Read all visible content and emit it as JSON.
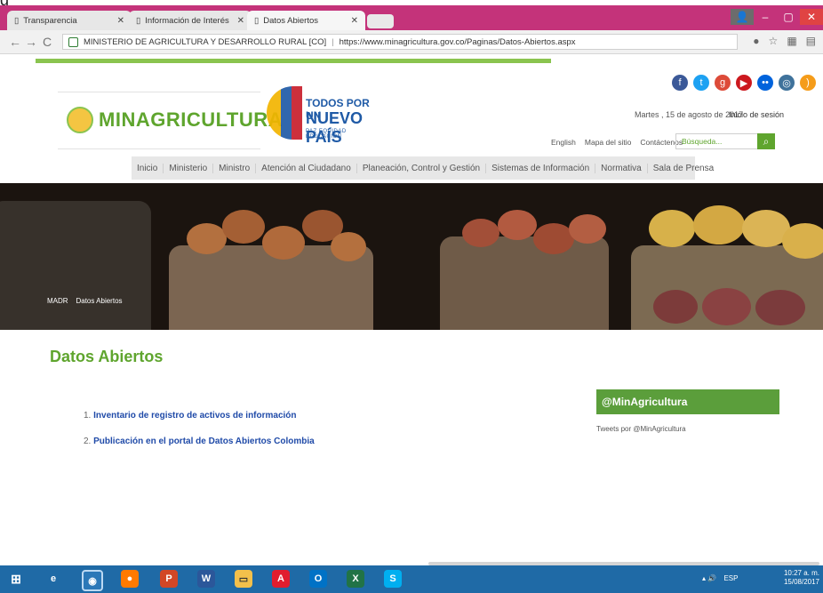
{
  "window": {
    "top_glyph": "g",
    "tabs": [
      {
        "label": "Transparencia"
      },
      {
        "label": "Información de Interés"
      },
      {
        "label": "Datos Abiertos"
      }
    ],
    "address": {
      "site_identity": "MINISTERIO DE AGRICULTURA Y DESARROLLO RURAL [CO]",
      "url": "https://www.minagricultura.gov.co/Paginas/Datos-Abiertos.aspx"
    }
  },
  "site": {
    "brand": "MINAGRICULTURA",
    "campaign": {
      "line1": "TODOS POR UN",
      "line2": "NUEVO PAÍS",
      "line3": "PAZ  EQUIDAD  EDUCACIÓN"
    },
    "date_text": "Martes , 15 de agosto de 2017",
    "login_label": "Inicio de sesión",
    "utility_links": [
      "English",
      "Mapa del sitio",
      "Contáctenos"
    ],
    "search_placeholder": "Búsqueda...",
    "menu": [
      "Inicio",
      "Ministerio",
      "Ministro",
      "Atención al Ciudadano",
      "Planeación, Control y Gestión",
      "Sistemas de Información",
      "Normativa",
      "Sala de Prensa"
    ],
    "breadcrumb": {
      "root": "MADR",
      "current": "Datos Abiertos"
    }
  },
  "content": {
    "page_title": "Datos Abiertos",
    "items": [
      {
        "num": "1.",
        "label": "Inventario de registro de activos de información"
      },
      {
        "num": "2.",
        "label": "Publicación en el portal de Datos Abiertos Colombia"
      }
    ],
    "twitter": {
      "handle": "@MinAgricultura",
      "tweets_by": "Tweets por @MinAgricultura"
    }
  },
  "taskbar": {
    "tray_lang": "ESP",
    "time": "10:27 a. m.",
    "date": "15/08/2017"
  }
}
